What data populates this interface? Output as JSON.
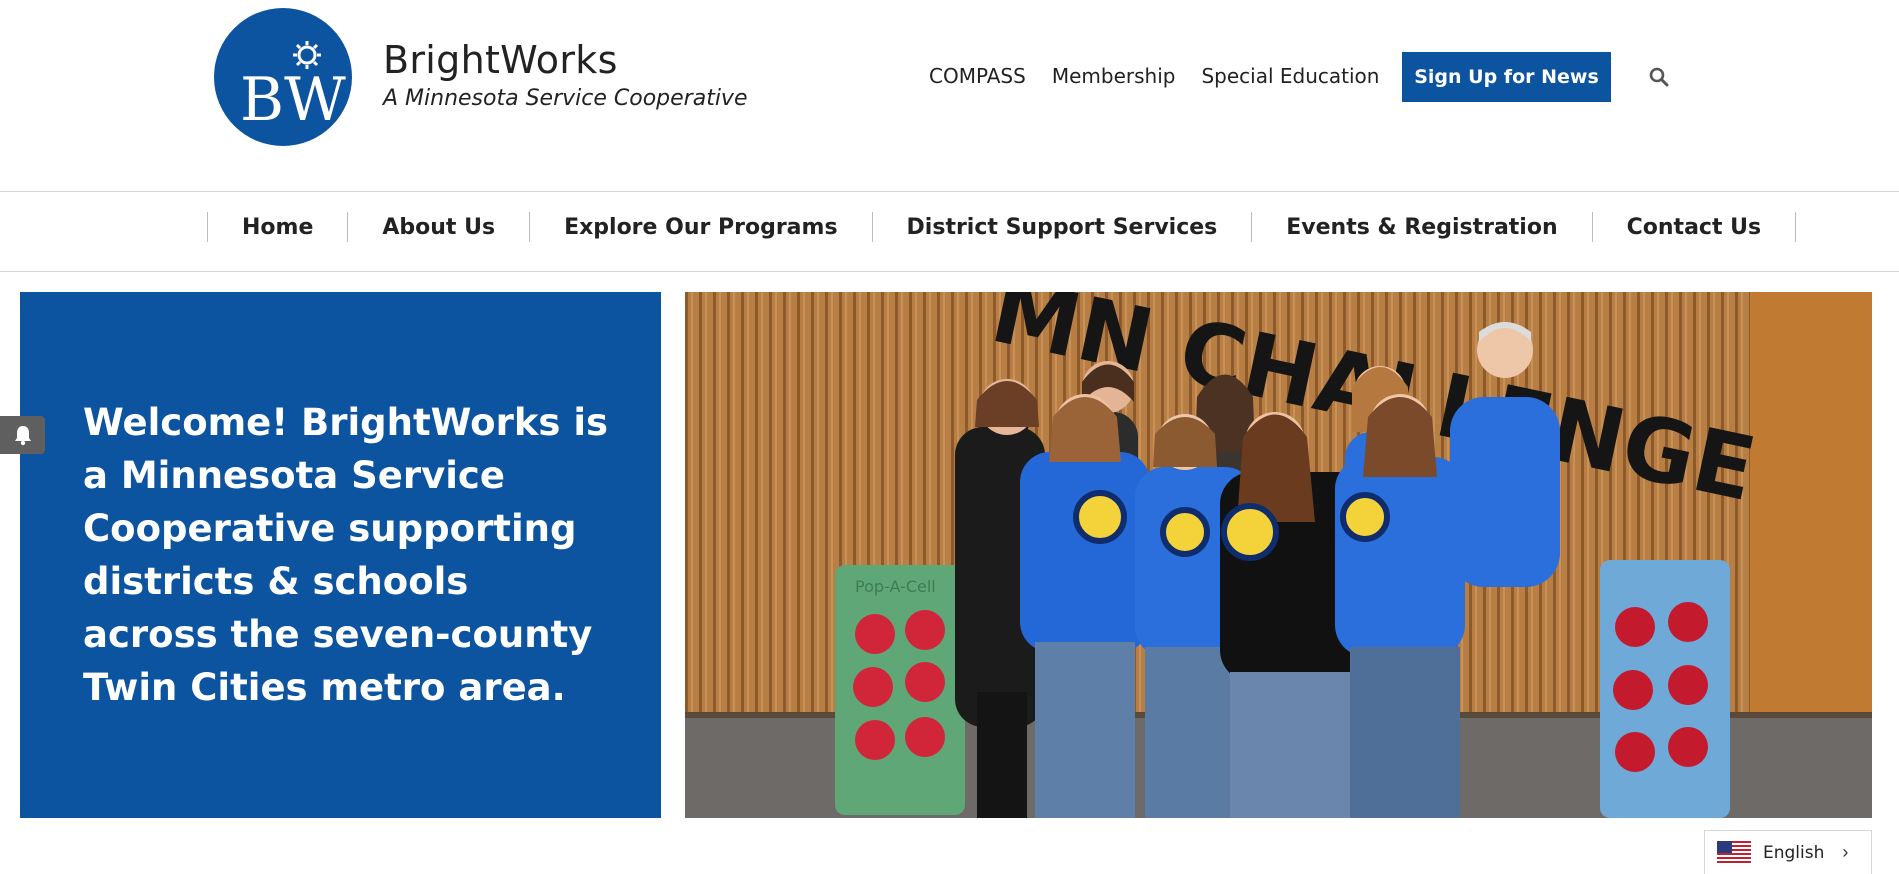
{
  "brand": {
    "logo_letters": "BW",
    "name": "BrightWorks",
    "tagline": "A Minnesota Service Cooperative",
    "color": "#0c54a0"
  },
  "top_links": [
    "COMPASS",
    "Membership",
    "Special Education"
  ],
  "signup_button": "Sign Up for News",
  "search_icon": "search-icon",
  "main_nav": [
    "Home",
    "About Us",
    "Explore Our Programs",
    "District Support Services",
    "Events & Registration",
    "Contact Us"
  ],
  "hero": {
    "text": "Welcome! BrightWorks is a Minnesota Service Cooperative supporting districts & schools across the seven-county Twin Cities metro area.",
    "bell_icon": "bell-icon"
  },
  "photo": {
    "balloon_text": "MN CHALLENGE",
    "board_label": "Pop-A-Cell"
  },
  "language": {
    "label": "English",
    "flag_icon": "us-flag-icon",
    "chevron_icon": "chevron-right-icon"
  }
}
